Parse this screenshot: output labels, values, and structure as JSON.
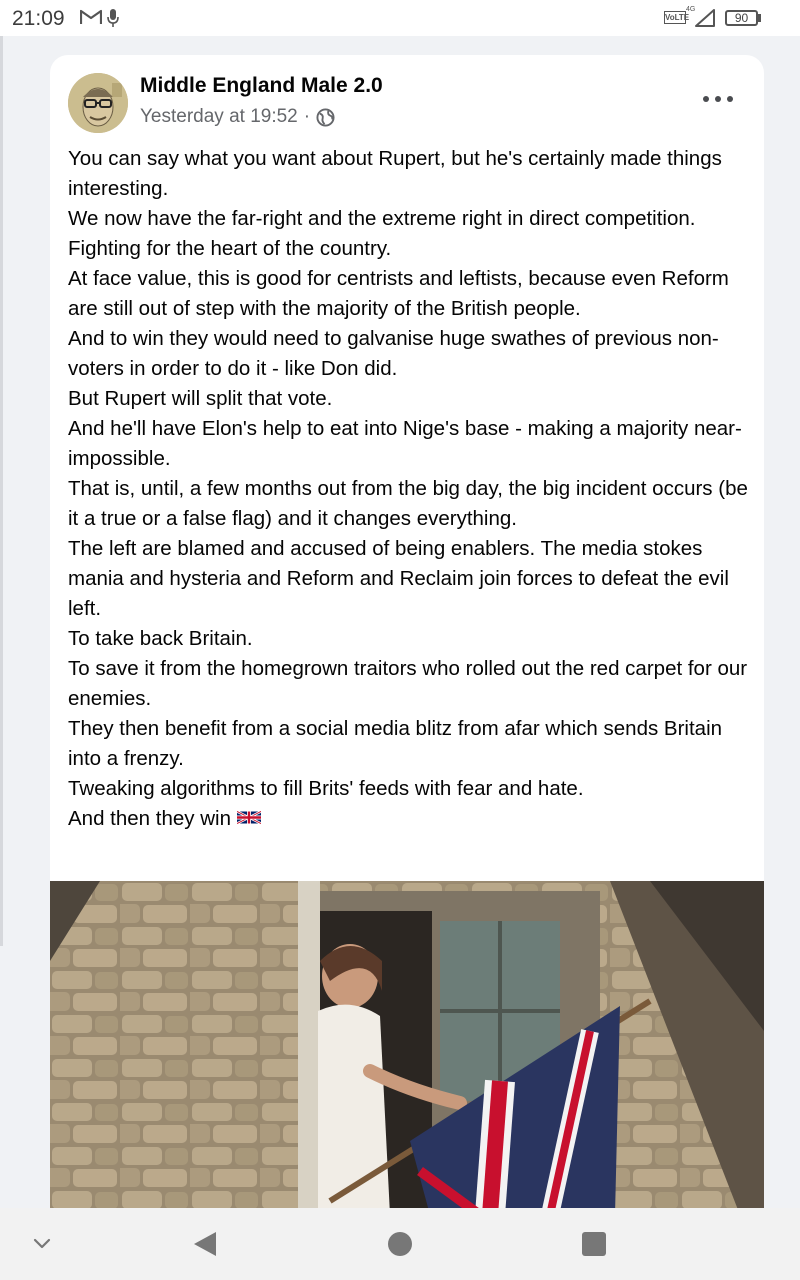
{
  "status_bar": {
    "time": "21:09",
    "volte": "VoLTE",
    "network": "4G",
    "battery": "90"
  },
  "post": {
    "author": "Middle England Male 2.0",
    "timestamp": "Yesterday at 19:52",
    "separator": "·",
    "privacy_icon": "globe-icon",
    "lines": [
      "You can say what you want about Rupert, but he's certainly made things interesting.",
      "We now have the far-right and the extreme right in direct competition.",
      "Fighting for the heart of the country.",
      "At face value, this is good for centrists and leftists, because even Reform are still out of step with the majority of the British people.",
      "And to win they would need to galvanise huge swathes of previous non-voters in order to do it - like Don did.",
      "But Rupert will split that vote.",
      "And he'll have Elon's help to eat into Nige's base - making a majority near-impossible.",
      "That is, until, a few months out from the big day, the big incident occurs (be it a true or a false flag) and it changes everything.",
      "The left are blamed and accused of being enablers. The media stokes mania and hysteria and Reform and Reclaim join forces to defeat the evil left.",
      "To take back Britain.",
      "To save it from the homegrown traitors who rolled out the red carpet for our enemies.",
      "They then benefit from a social media blitz from afar which sends Britain into a frenzy.",
      "Tweaking algorithms to fill Brits' feeds with fear and hate.",
      "And then they win"
    ],
    "final_emoji": "uk-flag-emoji"
  },
  "colors": {
    "background": "#f0f2f5",
    "card": "#ffffff",
    "text": "#050505",
    "meta": "#65676b"
  }
}
